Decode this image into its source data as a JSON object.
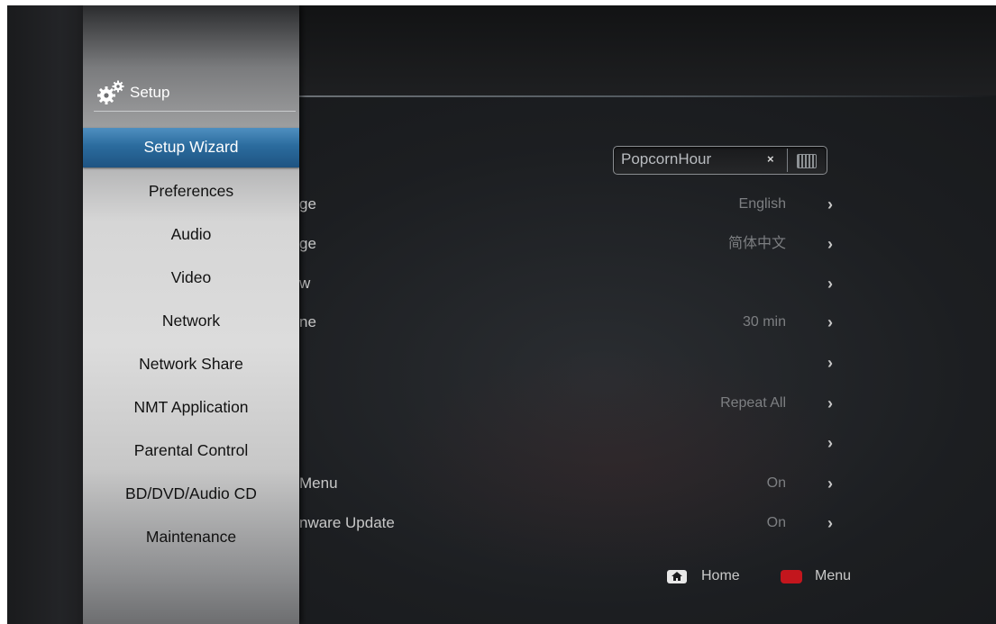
{
  "sidebar": {
    "title": "Setup",
    "items": [
      {
        "label": "Setup Wizard",
        "selected": true
      },
      {
        "label": "Preferences"
      },
      {
        "label": "Audio"
      },
      {
        "label": "Video"
      },
      {
        "label": "Network"
      },
      {
        "label": "Network Share"
      },
      {
        "label": "NMT Application"
      },
      {
        "label": "Parental Control"
      },
      {
        "label": "BD/DVD/Audio CD"
      },
      {
        "label": "Maintenance"
      }
    ]
  },
  "device_name": {
    "value": "PopcornHour",
    "clear": "×"
  },
  "settings": [
    {
      "label": "ge",
      "value": "English"
    },
    {
      "label": "ge",
      "value": "简体中文"
    },
    {
      "label": "w",
      "value": ""
    },
    {
      "label": "ne",
      "value": "30 min"
    },
    {
      "label": "",
      "value": ""
    },
    {
      "label": "",
      "value": "Repeat All"
    },
    {
      "label": "",
      "value": ""
    },
    {
      "label": "Menu",
      "value": "On"
    },
    {
      "label": "nware Update",
      "value": "On"
    }
  ],
  "chevron_glyph": "›",
  "legend": {
    "home_label": "Home",
    "menu_label": "Menu",
    "menu_color": "#c3161d"
  },
  "colors": {
    "selection": "#2b6c9e"
  },
  "icons": {
    "setup": "gear-icon",
    "keyboard": "keyboard-icon",
    "home": "home-icon",
    "red_key": "red-key-icon"
  }
}
